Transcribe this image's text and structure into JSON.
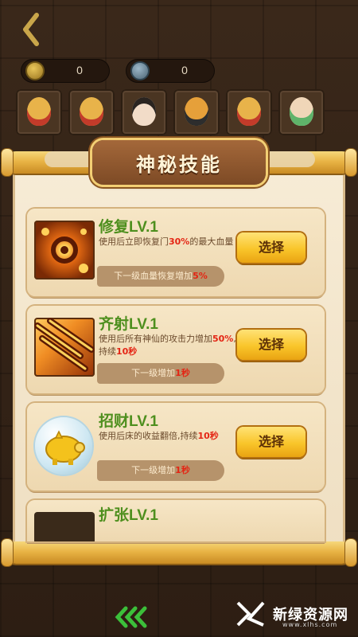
{
  "topbar": {
    "coin_value": "0",
    "energy_value": "0"
  },
  "heroes": [
    {
      "name": "hero-1",
      "color": "#e8b34a"
    },
    {
      "name": "hero-2",
      "color": "#e8b34a"
    },
    {
      "name": "hero-3",
      "color": "#2a2420"
    },
    {
      "name": "hero-4",
      "color": "#e6a03a"
    },
    {
      "name": "hero-5",
      "color": "#e8b34a"
    },
    {
      "name": "hero-6",
      "color": "#5fb36a"
    }
  ],
  "panel": {
    "title": "神秘技能"
  },
  "skills": [
    {
      "name": "修复LV.1",
      "desc_pre": "使用后立即恢复门",
      "desc_hl": "30%",
      "desc_post": "的最大血量",
      "next_pre": "下一级血量恢复增加",
      "next_hl": "5%",
      "button": "选择",
      "icon": "gear-repair-icon"
    },
    {
      "name": "齐射LV.1",
      "desc_pre": "使用后所有神仙的攻击力增加",
      "desc_hl": "50%",
      "desc_post": ",持续",
      "desc_hl2": "10秒",
      "next_pre": "下一级增加",
      "next_hl": "1秒",
      "button": "选择",
      "icon": "volley-arrows-icon"
    },
    {
      "name": "招财LV.1",
      "desc_pre": "使用后床的收益翻倍,持续",
      "desc_hl": "10秒",
      "next_pre": "下一级增加",
      "next_hl": "1秒",
      "button": "选择",
      "icon": "golden-pig-icon"
    },
    {
      "name": "扩张LV.1"
    }
  ],
  "watermark": {
    "text": "新绿资源网",
    "sub": "www.xlhs.com"
  },
  "colors": {
    "accent_green": "#4e8f1e",
    "highlight_red": "#e42514",
    "button_gold": "#f9c52a"
  }
}
